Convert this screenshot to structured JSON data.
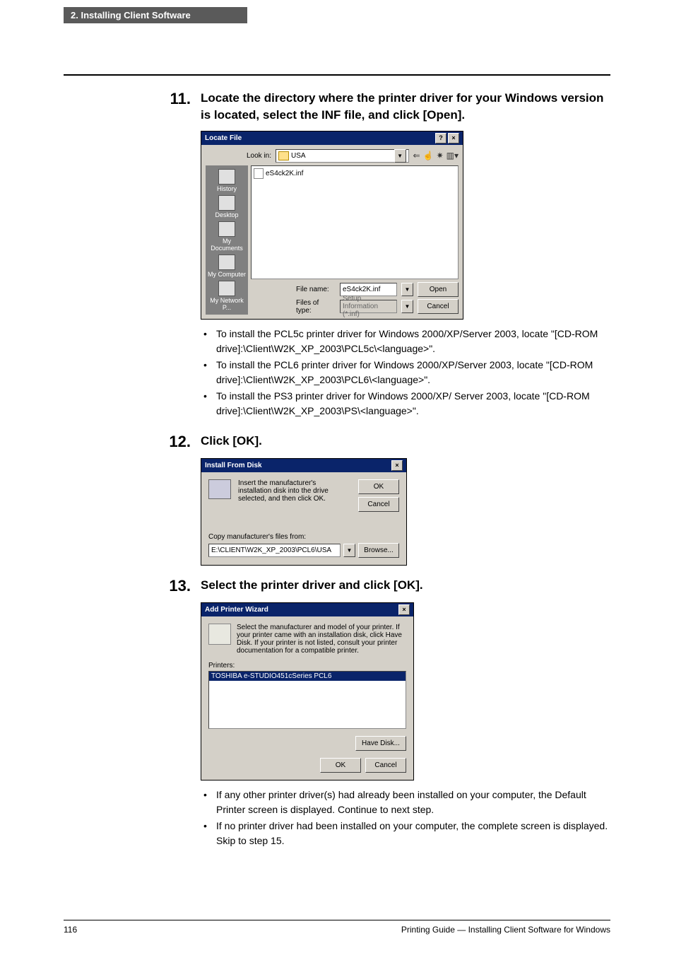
{
  "header": {
    "section": "2. Installing Client Software"
  },
  "steps": {
    "s11": {
      "num": "11.",
      "title": "Locate the directory where the printer driver for your Windows version is located, select the INF file, and click [Open].",
      "bullets": [
        "To install the PCL5c printer driver for Windows 2000/XP/Server 2003, locate \"[CD-ROM drive]:\\Client\\W2K_XP_2003\\PCL5c\\<language>\".",
        "To install the PCL6 printer driver for Windows 2000/XP/Server 2003, locate \"[CD-ROM drive]:\\Client\\W2K_XP_2003\\PCL6\\<language>\".",
        "To install the PS3 printer driver for Windows 2000/XP/ Server 2003, locate \"[CD-ROM drive]:\\Client\\W2K_XP_2003\\PS\\<language>\"."
      ]
    },
    "s12": {
      "num": "12.",
      "title": "Click [OK]."
    },
    "s13": {
      "num": "13.",
      "title": "Select the printer driver and click [OK].",
      "bullets": [
        "If any other printer driver(s) had already been installed on your computer, the Default Printer screen is displayed.  Continue to next step.",
        "If no printer driver had been installed on your computer, the complete screen is displayed.   Skip to step 15."
      ]
    }
  },
  "locate": {
    "title": "Locate File",
    "helpBtn": "?",
    "closeBtn": "×",
    "lookin_label": "Look in:",
    "lookin_value": "USA",
    "file_item": "eS4ck2K.inf",
    "places": [
      "History",
      "Desktop",
      "My Documents",
      "My Computer",
      "My Network P..."
    ],
    "filename_label": "File name:",
    "filename_value": "eS4ck2K.inf",
    "filetype_label": "Files of type:",
    "filetype_value": "Setup Information (*.inf)",
    "open": "Open",
    "cancel": "Cancel"
  },
  "ifd": {
    "title": "Install From Disk",
    "closeBtn": "×",
    "text": "Insert the manufacturer's installation disk into the drive selected, and then click OK.",
    "ok": "OK",
    "cancel": "Cancel",
    "copy_label": "Copy manufacturer's files from:",
    "path": "E:\\CLIENT\\W2K_XP_2003\\PCL6\\USA",
    "browse": "Browse..."
  },
  "apw": {
    "title": "Add Printer Wizard",
    "closeBtn": "×",
    "text": "Select the manufacturer and model of your printer. If your printer came with an installation disk, click Have Disk. If your printer is not listed, consult your printer documentation for a compatible printer.",
    "printers_label": "Printers:",
    "item": "TOSHIBA e-STUDIO451cSeries PCL6",
    "have_disk": "Have Disk...",
    "ok": "OK",
    "cancel": "Cancel"
  },
  "footer": {
    "page": "116",
    "right": "Printing Guide — Installing Client Software for Windows"
  }
}
